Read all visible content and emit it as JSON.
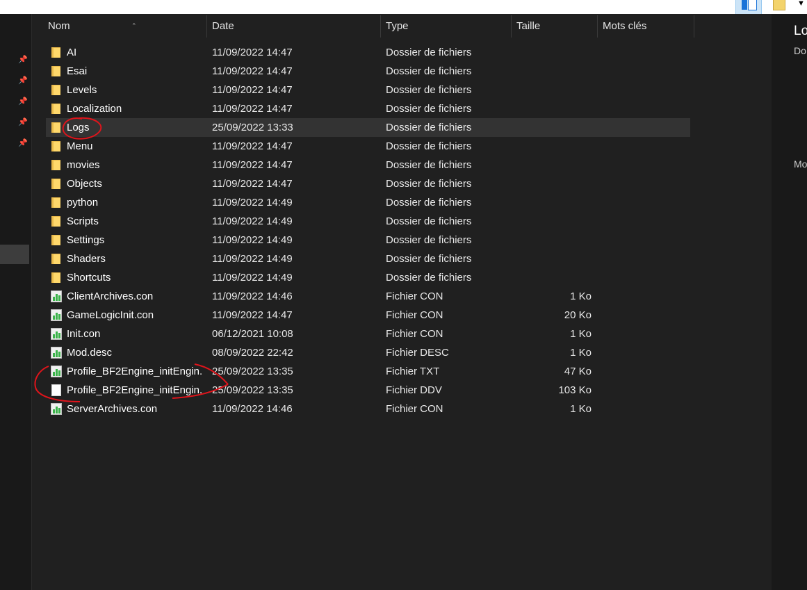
{
  "columns": {
    "name": "Nom",
    "date": "Date",
    "type": "Type",
    "size": "Taille",
    "tags": "Mots clés"
  },
  "files": [
    {
      "name": "AI",
      "date": "11/09/2022 14:47",
      "type": "Dossier de fichiers",
      "size": "",
      "icon": "folder-icon"
    },
    {
      "name": "Esai",
      "date": "11/09/2022 14:47",
      "type": "Dossier de fichiers",
      "size": "",
      "icon": "folder-icon"
    },
    {
      "name": "Levels",
      "date": "11/09/2022 14:47",
      "type": "Dossier de fichiers",
      "size": "",
      "icon": "folder-icon"
    },
    {
      "name": "Localization",
      "date": "11/09/2022 14:47",
      "type": "Dossier de fichiers",
      "size": "",
      "icon": "folder-icon"
    },
    {
      "name": "Logs",
      "date": "25/09/2022 13:33",
      "type": "Dossier de fichiers",
      "size": "",
      "icon": "folder-icon",
      "selected": true
    },
    {
      "name": "Menu",
      "date": "11/09/2022 14:47",
      "type": "Dossier de fichiers",
      "size": "",
      "icon": "folder-icon"
    },
    {
      "name": "movies",
      "date": "11/09/2022 14:47",
      "type": "Dossier de fichiers",
      "size": "",
      "icon": "folder-icon"
    },
    {
      "name": "Objects",
      "date": "11/09/2022 14:47",
      "type": "Dossier de fichiers",
      "size": "",
      "icon": "folder-icon"
    },
    {
      "name": "python",
      "date": "11/09/2022 14:49",
      "type": "Dossier de fichiers",
      "size": "",
      "icon": "folder-icon"
    },
    {
      "name": "Scripts",
      "date": "11/09/2022 14:49",
      "type": "Dossier de fichiers",
      "size": "",
      "icon": "folder-icon"
    },
    {
      "name": "Settings",
      "date": "11/09/2022 14:49",
      "type": "Dossier de fichiers",
      "size": "",
      "icon": "folder-icon"
    },
    {
      "name": "Shaders",
      "date": "11/09/2022 14:49",
      "type": "Dossier de fichiers",
      "size": "",
      "icon": "folder-icon"
    },
    {
      "name": "Shortcuts",
      "date": "11/09/2022 14:49",
      "type": "Dossier de fichiers",
      "size": "",
      "icon": "folder-icon"
    },
    {
      "name": "ClientArchives.con",
      "date": "11/09/2022 14:46",
      "type": "Fichier CON",
      "size": "1 Ko",
      "icon": "con-file-icon"
    },
    {
      "name": "GameLogicInit.con",
      "date": "11/09/2022 14:47",
      "type": "Fichier CON",
      "size": "20 Ko",
      "icon": "con-file-icon"
    },
    {
      "name": "Init.con",
      "date": "06/12/2021 10:08",
      "type": "Fichier CON",
      "size": "1 Ko",
      "icon": "con-file-icon"
    },
    {
      "name": "Mod.desc",
      "date": "08/09/2022 22:42",
      "type": "Fichier DESC",
      "size": "1 Ko",
      "icon": "con-file-icon"
    },
    {
      "name": "Profile_BF2Engine_initEngin...",
      "date": "25/09/2022 13:35",
      "type": "Fichier TXT",
      "size": "47 Ko",
      "icon": "con-file-icon"
    },
    {
      "name": "Profile_BF2Engine_initEngin...",
      "date": "25/09/2022 13:35",
      "type": "Fichier DDV",
      "size": "103 Ko",
      "icon": "blank-file-icon"
    },
    {
      "name": "ServerArchives.con",
      "date": "11/09/2022 14:46",
      "type": "Fichier CON",
      "size": "1 Ko",
      "icon": "con-file-icon"
    }
  ],
  "preview": {
    "title": "Lo",
    "line1": "Do",
    "line2": "Mo"
  },
  "colors": {
    "background": "#202020",
    "selected_row": "#333333",
    "annotation": "#e0141b",
    "folder": "#ffd86b"
  }
}
